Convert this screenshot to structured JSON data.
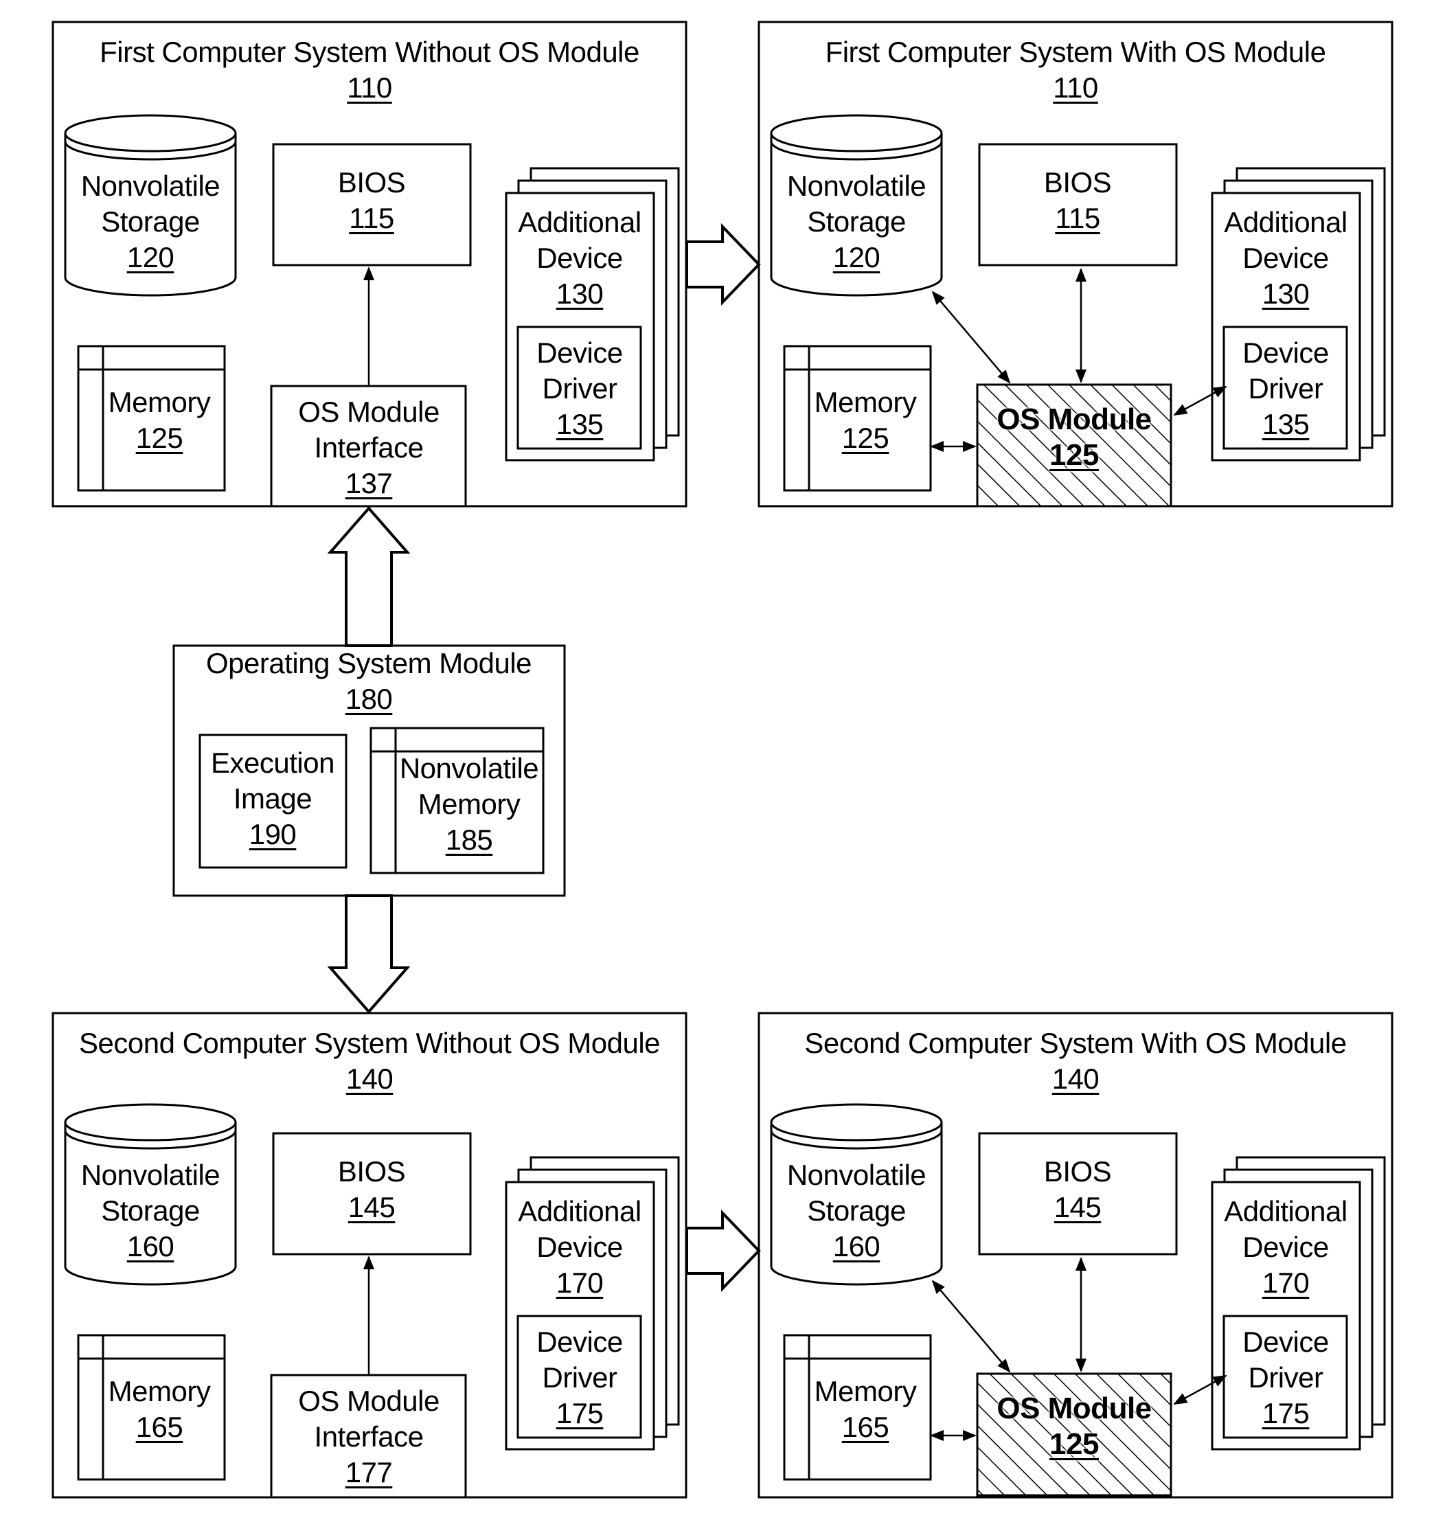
{
  "figure": {
    "systems": [
      {
        "id": "first-without",
        "title": "First Computer System Without OS Module",
        "number": "110",
        "storage": {
          "label": [
            "Nonvolatile",
            "Storage"
          ],
          "number": "120"
        },
        "bios": {
          "label": [
            "BIOS"
          ],
          "number": "115"
        },
        "memory": {
          "label": [
            "Memory"
          ],
          "number": "125"
        },
        "device": {
          "label": [
            "Additional",
            "Device"
          ],
          "number": "130"
        },
        "driver": {
          "label": [
            "Device",
            "Driver"
          ],
          "number": "135"
        },
        "interface": {
          "label": [
            "OS Module",
            "Interface"
          ],
          "number": "137"
        }
      },
      {
        "id": "first-with",
        "title": "First Computer System With OS Module",
        "number": "110",
        "storage": {
          "label": [
            "Nonvolatile",
            "Storage"
          ],
          "number": "120"
        },
        "bios": {
          "label": [
            "BIOS"
          ],
          "number": "115"
        },
        "memory": {
          "label": [
            "Memory"
          ],
          "number": "125"
        },
        "device": {
          "label": [
            "Additional",
            "Device"
          ],
          "number": "130"
        },
        "driver": {
          "label": [
            "Device",
            "Driver"
          ],
          "number": "135"
        },
        "os_module": {
          "label": [
            "OS Module"
          ],
          "number": "125"
        }
      },
      {
        "id": "second-without",
        "title": "Second Computer System Without OS Module",
        "number": "140",
        "storage": {
          "label": [
            "Nonvolatile",
            "Storage"
          ],
          "number": "160"
        },
        "bios": {
          "label": [
            "BIOS"
          ],
          "number": "145"
        },
        "memory": {
          "label": [
            "Memory"
          ],
          "number": "165"
        },
        "device": {
          "label": [
            "Additional",
            "Device"
          ],
          "number": "170"
        },
        "driver": {
          "label": [
            "Device",
            "Driver"
          ],
          "number": "175"
        },
        "interface": {
          "label": [
            "OS Module",
            "Interface"
          ],
          "number": "177"
        }
      },
      {
        "id": "second-with",
        "title": "Second Computer System With OS Module",
        "number": "140",
        "storage": {
          "label": [
            "Nonvolatile",
            "Storage"
          ],
          "number": "160"
        },
        "bios": {
          "label": [
            "BIOS"
          ],
          "number": "145"
        },
        "memory": {
          "label": [
            "Memory"
          ],
          "number": "165"
        },
        "device": {
          "label": [
            "Additional",
            "Device"
          ],
          "number": "170"
        },
        "driver": {
          "label": [
            "Device",
            "Driver"
          ],
          "number": "175"
        },
        "os_module": {
          "label": [
            "OS Module"
          ],
          "number": "125"
        }
      }
    ],
    "operating_system_module": {
      "title": "Operating System Module",
      "number": "180",
      "execution_image": {
        "label": [
          "Execution",
          "Image"
        ],
        "number": "190"
      },
      "nonvolatile_memory": {
        "label": [
          "Nonvolatile",
          "Memory"
        ],
        "number": "185"
      }
    },
    "colors": {
      "stroke": "#000000",
      "background": "#ffffff"
    }
  }
}
